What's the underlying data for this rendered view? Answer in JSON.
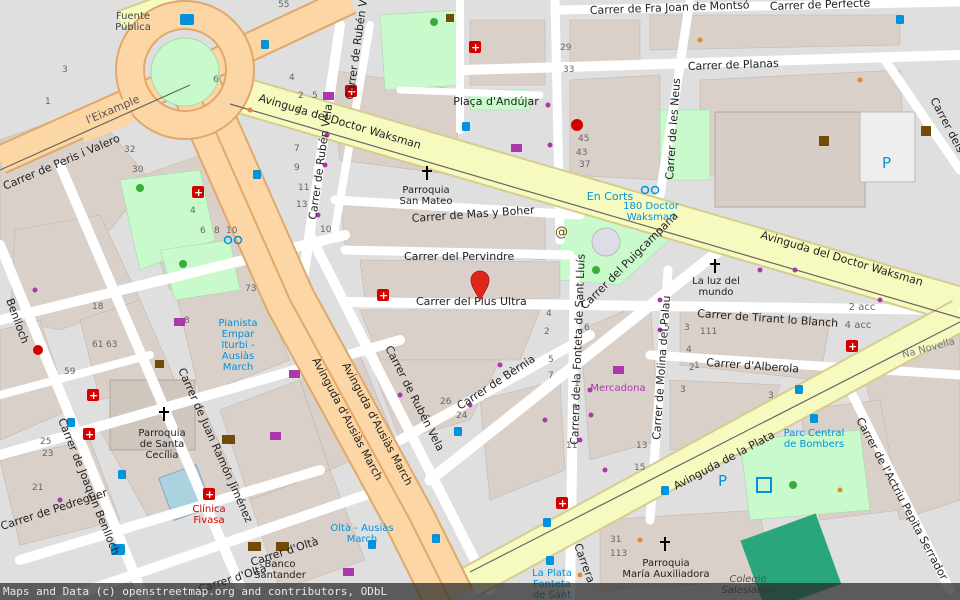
{
  "map": {
    "center_marker": "red-location-pin-icon",
    "colors": {
      "background": "#f2efe9",
      "residential": "#e0dfdf",
      "building": "#d9d0c9",
      "park": "#c8facc",
      "primary_road": "#fcd6a4",
      "secondary_road": "#f7fabf",
      "minor_road": "#ffffff",
      "pedestrian": "#dddde8",
      "pin": "#e0251b",
      "poi_red": "#d40000",
      "poi_blue": "#0092da",
      "poi_purple": "#ac39ac",
      "poi_green": "#39ac39"
    },
    "streets": [
      {
        "id": "waksman",
        "text": "Avinguda del Doctor Waksman"
      },
      {
        "id": "waksman2",
        "text": "Avinguda del Doctor Waksman"
      },
      {
        "id": "ausias1",
        "text": "Avinguda d'Ausiàs March"
      },
      {
        "id": "ausias2",
        "text": "Avinguda d'Ausiàs March"
      },
      {
        "id": "plata",
        "text": "Avinguda de la Plata"
      },
      {
        "id": "perisvalero",
        "text": "Carrer de Peris i Valero"
      },
      {
        "id": "eixample",
        "text": "l'Eixample"
      },
      {
        "id": "rubenvela1",
        "text": "Carrer de Rubén Vela"
      },
      {
        "id": "rubenvela2",
        "text": "Carrer de Rubén Vela"
      },
      {
        "id": "rubenvela3",
        "text": "Carrer de Rubén Vela"
      },
      {
        "id": "masyboher",
        "text": "Carrer de Mas y Boher"
      },
      {
        "id": "pervindre",
        "text": "Carrer del Pervindre"
      },
      {
        "id": "plusultra",
        "text": "Carrer del Plus Ultra"
      },
      {
        "id": "bernia",
        "text": "Carrer de Bèrnia"
      },
      {
        "id": "fontetacarrera",
        "text": "Carrera de la Fonteta de Sant Lluís"
      },
      {
        "id": "puigcampana",
        "text": "Carrer del Puigcampana"
      },
      {
        "id": "molinapalau",
        "text": "Carrer de Molina del Palau"
      },
      {
        "id": "tirant",
        "text": "Carrer de Tirant lo Blanch"
      },
      {
        "id": "alberola",
        "text": "Carrer d'Alberola"
      },
      {
        "id": "planas",
        "text": "Carrer de Planas"
      },
      {
        "id": "fraj",
        "text": "Carrer de Fra Joan de Montsó"
      },
      {
        "id": "perfecte",
        "text": "Carrer de Perfecte"
      },
      {
        "id": "neus",
        "text": "Carrer de les Neus"
      },
      {
        "id": "sants",
        "text": "Carrer dels Sants"
      },
      {
        "id": "juanramon",
        "text": "Carrer de Juan Ramón Jiménez"
      },
      {
        "id": "joaquin",
        "text": "Carrer de Joaquín Benlloch"
      },
      {
        "id": "benlloch",
        "text": "Benlloch"
      },
      {
        "id": "pedreguer",
        "text": "Carrer de Pedreguer"
      },
      {
        "id": "olta",
        "text": "Carrer d'Oltà"
      },
      {
        "id": "olta2",
        "text": "Carrer d'Oltà"
      },
      {
        "id": "actriu",
        "text": "Carrer de l'Actriu Pepita Serrador"
      },
      {
        "id": "novella",
        "text": "Na Novella"
      },
      {
        "id": "carrera",
        "text": "Carrera"
      }
    ],
    "places": [
      {
        "id": "fuente",
        "text": "Fuente\nPública"
      },
      {
        "id": "sanmateo",
        "text": "Parroquia\nSan Mateo"
      },
      {
        "id": "andujar",
        "text": "Plaça d'Andújar"
      },
      {
        "id": "encorts",
        "text": "En Corts"
      },
      {
        "id": "waksmanstop",
        "text": "180 Doctor\nWaksman"
      },
      {
        "id": "luz",
        "text": "La luz del\nmundo"
      },
      {
        "id": "pianista",
        "text": "Pianista\nEmpar\nIturbi -\nAusiàs\nMarch"
      },
      {
        "id": "santacecilia",
        "text": "Parroquia\nde Santa\nCecília"
      },
      {
        "id": "fivasa",
        "text": "Clínica\nFivasa"
      },
      {
        "id": "mercadona",
        "text": "Mercadona"
      },
      {
        "id": "bombers",
        "text": "Parc Central\nde Bombers"
      },
      {
        "id": "oltaausias",
        "text": "Oltà - Ausiàs\nMarch"
      },
      {
        "id": "bancosantander",
        "text": "Banco\nSantander"
      },
      {
        "id": "plataforn",
        "text": "La Plata\nFonteta\nde Sant"
      },
      {
        "id": "auxiliadora",
        "text": "Parroquia\nMaría Auxiliadora"
      },
      {
        "id": "salesianos",
        "text": "Colegio\nSalesianos"
      },
      {
        "id": "acc2",
        "text": "2 acc"
      },
      {
        "id": "acc4",
        "text": "4 acc"
      }
    ],
    "house_numbers": [
      "55",
      "3",
      "1",
      "6",
      "4",
      "2",
      "5",
      "3",
      "7",
      "9",
      "11",
      "13",
      "10",
      "8",
      "73",
      "18",
      "63",
      "61",
      "59",
      "32",
      "30",
      "4",
      "6",
      "8",
      "10",
      "29",
      "33",
      "45",
      "43",
      "37",
      "4",
      "2",
      "1",
      "6",
      "5",
      "3",
      "26",
      "24",
      "25",
      "23",
      "21",
      "15",
      "13",
      "11",
      "9",
      "7",
      "5",
      "3",
      "31",
      "113",
      "111",
      "4",
      "2",
      "1",
      "3"
    ]
  },
  "footer": {
    "attribution": "Maps and Data (c) openstreetmap.org and contributors, ODbL"
  }
}
